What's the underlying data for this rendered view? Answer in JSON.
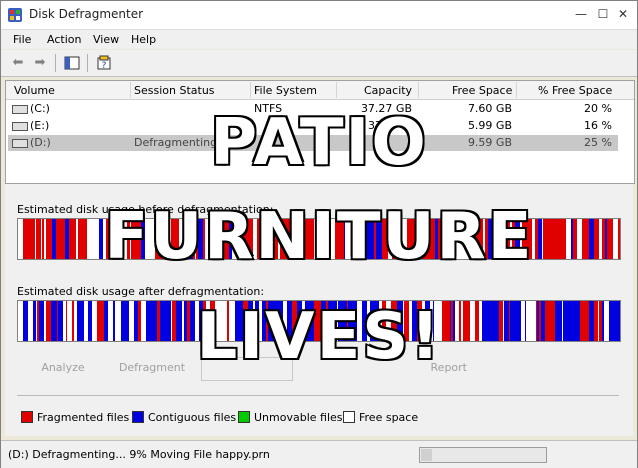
{
  "window": {
    "title": "Disk Defragmenter",
    "minimize": "—",
    "maximize": "☐",
    "close": "✕"
  },
  "menu": [
    "File",
    "Action",
    "View",
    "Help"
  ],
  "toolbar": {
    "back_icon": "back-arrow-icon",
    "forward_icon": "forward-arrow-icon"
  },
  "table": {
    "headers": [
      "Volume",
      "Session Status",
      "File System",
      "Capacity",
      "Free Space",
      "% Free Space"
    ],
    "rows": [
      {
        "volume": "(C:)",
        "status": "",
        "fs": "NTFS",
        "capacity": "37.27 GB",
        "free": "7.60 GB",
        "pct": "20 %"
      },
      {
        "volume": "(E:)",
        "status": "",
        "fs": "",
        "capacity": "37",
        "free": "5.99 GB",
        "pct": "16 %"
      },
      {
        "volume": "(D:)",
        "status": "Defragmenting...",
        "fs": "",
        "capacity": "",
        "free": "9.59 GB",
        "pct": "25 %"
      }
    ]
  },
  "before_label": "Estimated disk usage before defragmentation:",
  "after_label": "Estimated disk usage after defragmentation:",
  "buttons": {
    "analyze": "Analyze",
    "defragment": "Defragment",
    "report": "Report"
  },
  "legend": {
    "fragmented": "Fragmented files",
    "contiguous": "Contiguous files",
    "unmovable": "Unmovable files",
    "free": "Free space"
  },
  "colors": {
    "fragmented": "#e00000",
    "contiguous": "#0000e0",
    "unmovable": "#00cc00",
    "free": "#ffffff"
  },
  "status": {
    "text": "(D:) Defragmenting... 9%  Moving File happy.prn",
    "progress_percent": 9
  },
  "overlay": {
    "line1": "PATIO",
    "line2": "FURNITURE",
    "line3": "LIVES!"
  }
}
